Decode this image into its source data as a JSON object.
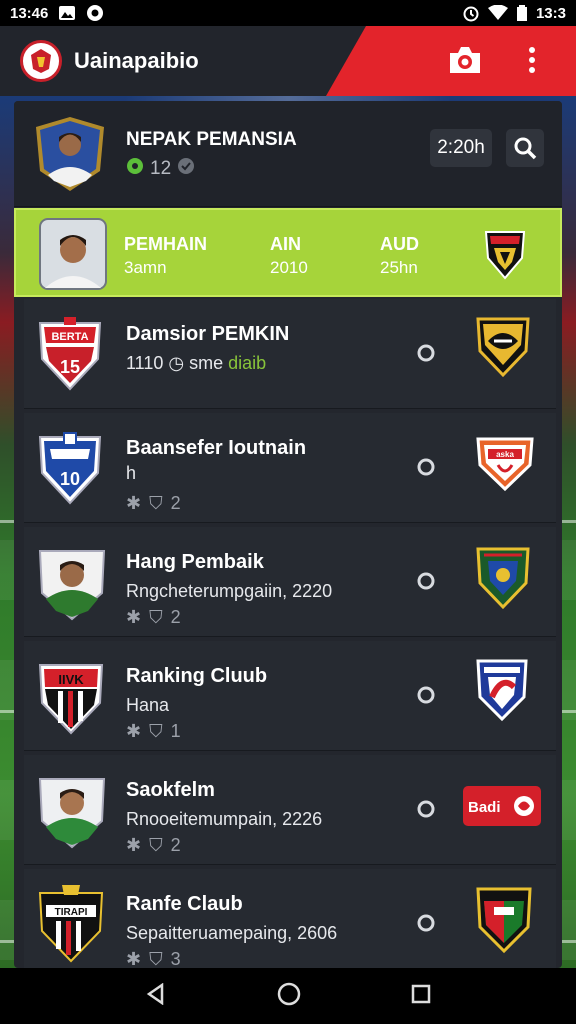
{
  "status_bar": {
    "time_left": "13:46",
    "time_right": "13:3"
  },
  "app_bar": {
    "title": "Uainapaibio"
  },
  "header": {
    "name": "NEPAK PEMANSIA",
    "sub": "12",
    "time": "2:20h"
  },
  "highlight": {
    "col1_label": "PEMHAIN",
    "col1_value": "3amn",
    "col2_label": "AIN",
    "col2_value": "2010",
    "col3_label": "AUD",
    "col3_value": "25hn"
  },
  "rows": [
    {
      "title": "Damsior PEMKIN",
      "sub_prefix": "1110",
      "sub_mid": "sme",
      "sub_accent": "diaib",
      "meta": ""
    },
    {
      "title": "Baansefer Ioutnain",
      "sub_prefix": "h",
      "sub_mid": "",
      "sub_accent": "",
      "meta": "2"
    },
    {
      "title": "Hang Pembaik",
      "sub_prefix": "Rngcheterumpgaiin, 2220",
      "sub_mid": "",
      "sub_accent": "",
      "meta": "2"
    },
    {
      "title": "Ranking Cluub",
      "sub_prefix": "Hana",
      "sub_mid": "",
      "sub_accent": "",
      "meta": "1"
    },
    {
      "title": "Saokfelm",
      "sub_prefix": "Rnooeitemumpain, 2226",
      "sub_mid": "",
      "sub_accent": "",
      "meta": "2"
    },
    {
      "title": "Ranfe Claub",
      "sub_prefix": "Sepaitteruamepaing, 2606",
      "sub_mid": "",
      "sub_accent": "",
      "meta": "3"
    }
  ],
  "badges": {
    "row1": "",
    "row2": "aska",
    "row5": "Badi"
  },
  "crest_text": {
    "row1_top": "BERTA",
    "row1_num": "15",
    "row2_num": "10",
    "row4": "IIVK",
    "row6": "TIRAPI"
  },
  "colors": {
    "accent_red": "#e3242b",
    "highlight_green": "#a6d43a",
    "row_bg": "#262a31",
    "app_bar_bg": "#22252c"
  }
}
